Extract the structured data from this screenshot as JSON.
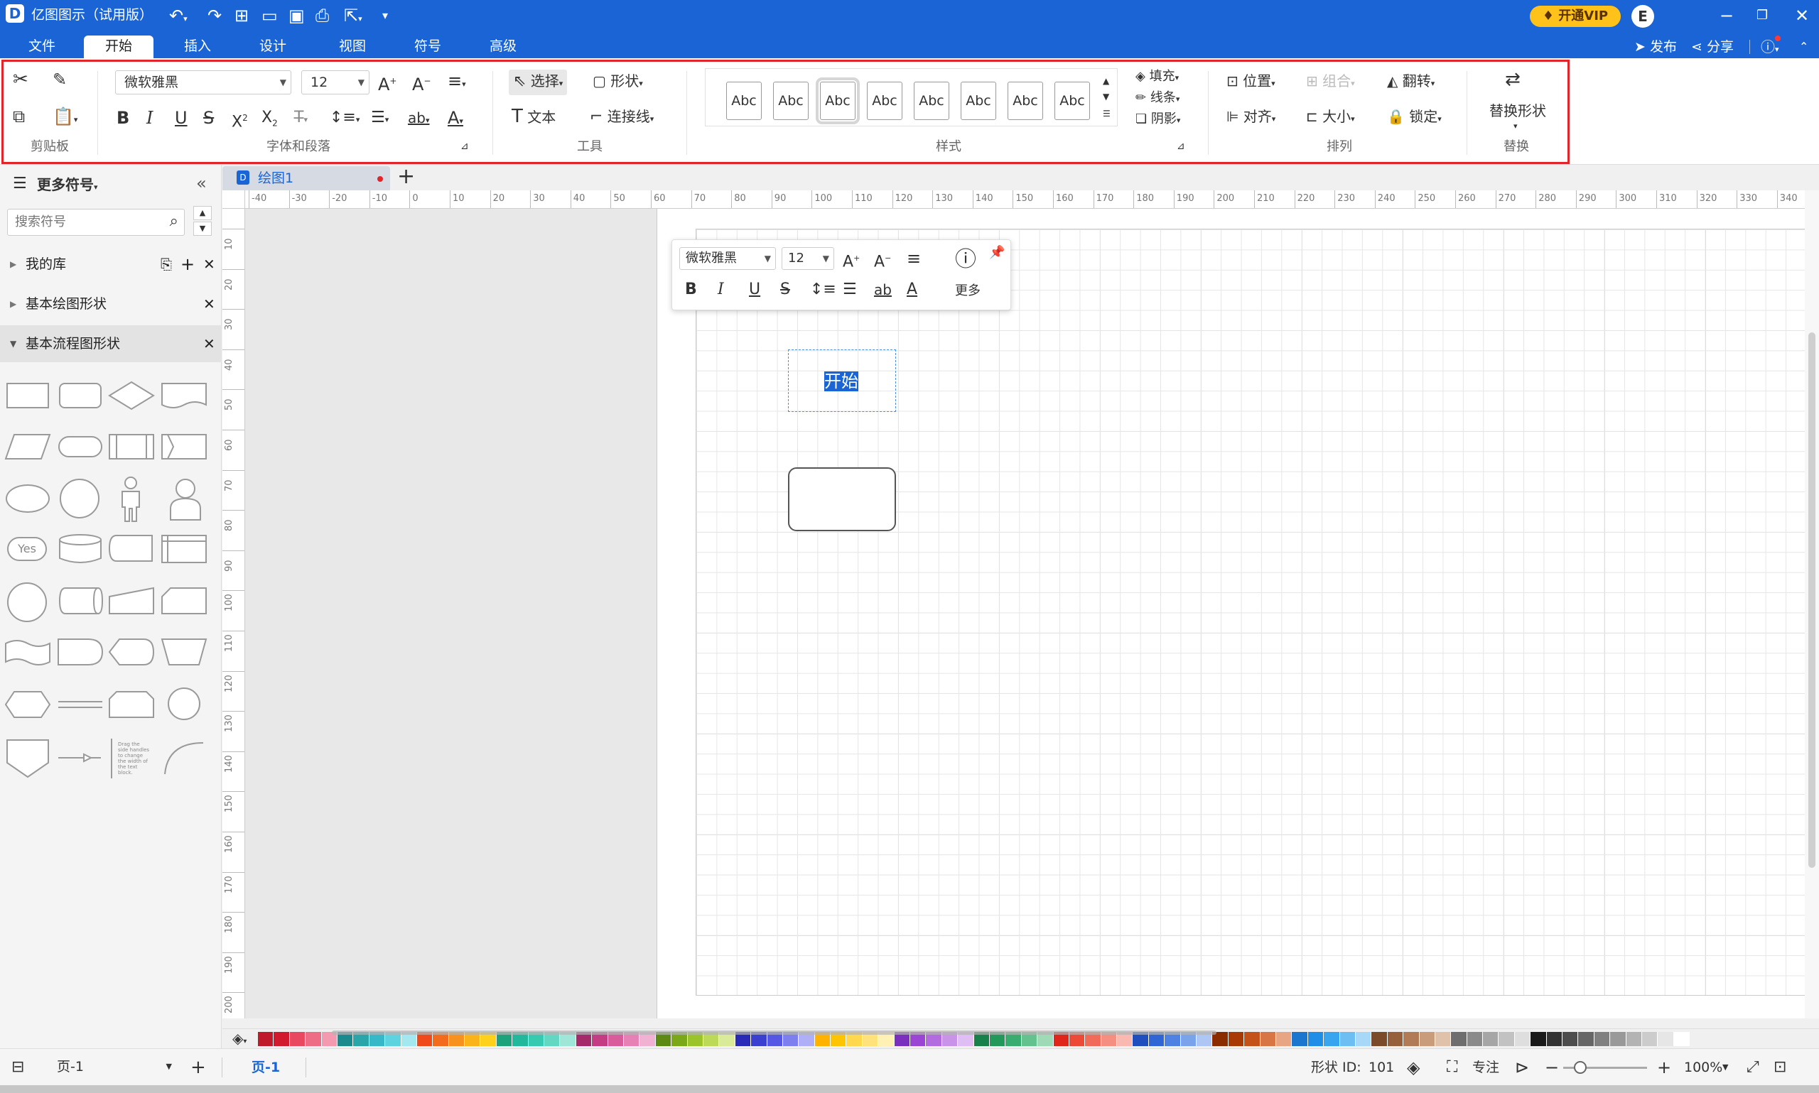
{
  "app": {
    "title": "亿图图示（试用版）",
    "vip_label": "开通VIP",
    "avatar_letter": "E",
    "publish": "发布",
    "share": "分享"
  },
  "menu": {
    "tabs": [
      "文件",
      "开始",
      "插入",
      "设计",
      "视图",
      "符号",
      "高级"
    ],
    "active": "开始"
  },
  "ribbon": {
    "groups": {
      "clipboard": "剪贴板",
      "font": "字体和段落",
      "tools": "工具",
      "style": "样式",
      "arrange": "排列",
      "replace": "替换"
    },
    "font_name": "微软雅黑",
    "font_size": "12",
    "tools": {
      "select": "选择",
      "shape": "形状",
      "text": "文本",
      "connector": "连接线"
    },
    "style_sample": "Abc",
    "style_opts": {
      "fill": "填充",
      "line": "线条",
      "shadow": "阴影"
    },
    "arrange": {
      "position": "位置",
      "group": "组合",
      "flip": "翻转",
      "align": "对齐",
      "size": "大小",
      "lock": "锁定"
    },
    "replace_shape": "替换形状"
  },
  "sidebar": {
    "title": "更多符号",
    "search_placeholder": "搜索符号",
    "libraries": [
      "我的库",
      "基本绘图形状",
      "基本流程图形状"
    ],
    "yes_label": "Yes",
    "note_text": "Drag the side handles to change the width of the text block."
  },
  "doc": {
    "tab": "绘图1",
    "add": "+"
  },
  "ruler": {
    "h": [
      "-40",
      "-30",
      "-20",
      "-10",
      "0",
      "10",
      "20",
      "30",
      "40",
      "50",
      "60",
      "70",
      "80",
      "90",
      "100",
      "110",
      "120",
      "130",
      "140",
      "150",
      "160",
      "170",
      "180",
      "190",
      "200",
      "210",
      "220",
      "230",
      "240",
      "250",
      "260",
      "270",
      "280",
      "290",
      "300",
      "310",
      "320",
      "330",
      "340"
    ],
    "v": [
      "10",
      "20",
      "30",
      "40",
      "50",
      "60",
      "70",
      "80",
      "90",
      "100",
      "110",
      "120",
      "130",
      "140",
      "150",
      "160",
      "170",
      "180",
      "190",
      "200"
    ]
  },
  "float_toolbar": {
    "font": "微软雅黑",
    "size": "12",
    "more": "更多"
  },
  "canvas": {
    "selected_text": "开始"
  },
  "palette": [
    "#c0192c",
    "#d21a2f",
    "#e84860",
    "#ef6c86",
    "#f39ab0",
    "#1b8a8f",
    "#2aa6a9",
    "#35b9c6",
    "#5dd3e0",
    "#a2e8ee",
    "#f04a1a",
    "#f36c1d",
    "#f7921e",
    "#fbb31a",
    "#ffd11a",
    "#1ca37b",
    "#22b89b",
    "#36cbb1",
    "#62d8c3",
    "#9ee6d8",
    "#a52a6b",
    "#c43d84",
    "#d85b9c",
    "#e680b5",
    "#f1b1d2",
    "#5c8a13",
    "#7aa818",
    "#9bc42a",
    "#bcd957",
    "#d9ea98",
    "#2a2ab8",
    "#3b3fd0",
    "#5658e4",
    "#7e7fef",
    "#aeaff7",
    "#ffb300",
    "#ffc400",
    "#ffd84d",
    "#ffe37a",
    "#fff0b3",
    "#7b2fbe",
    "#9a45d4",
    "#b36be0",
    "#c993ea",
    "#dfbff3",
    "#18804a",
    "#22985a",
    "#38ad6f",
    "#63c28e",
    "#9fdab6",
    "#e0261a",
    "#ec4a37",
    "#f16b5a",
    "#f58f82",
    "#f9b9b0",
    "#1f4fbf",
    "#2e66d6",
    "#4d82e3",
    "#7aa3ec",
    "#adc6f4",
    "#8b2c00",
    "#a83a05",
    "#c4531a",
    "#d97646",
    "#e8a584",
    "#1b76cf",
    "#1f8ee6",
    "#3aa5ef",
    "#6cbef3",
    "#a8d8f8",
    "#7a4a2a",
    "#96603c",
    "#b07b56",
    "#c99c7c",
    "#e0c2aa",
    "#6e6e6e",
    "#8a8a8a",
    "#a6a6a6",
    "#c2c2c2",
    "#dedede",
    "#1a1a1a",
    "#333333",
    "#4d4d4d",
    "#666666",
    "#808080",
    "#999999",
    "#b3b3b3",
    "#cccccc",
    "#e6e6e6",
    "#ffffff"
  ],
  "status": {
    "page_selector": "页-1",
    "page_tab": "页-1",
    "shape_id_label": "形状 ID:",
    "shape_id": "101",
    "focus": "专注",
    "zoom": "100%",
    "slider_value": 0.2
  }
}
